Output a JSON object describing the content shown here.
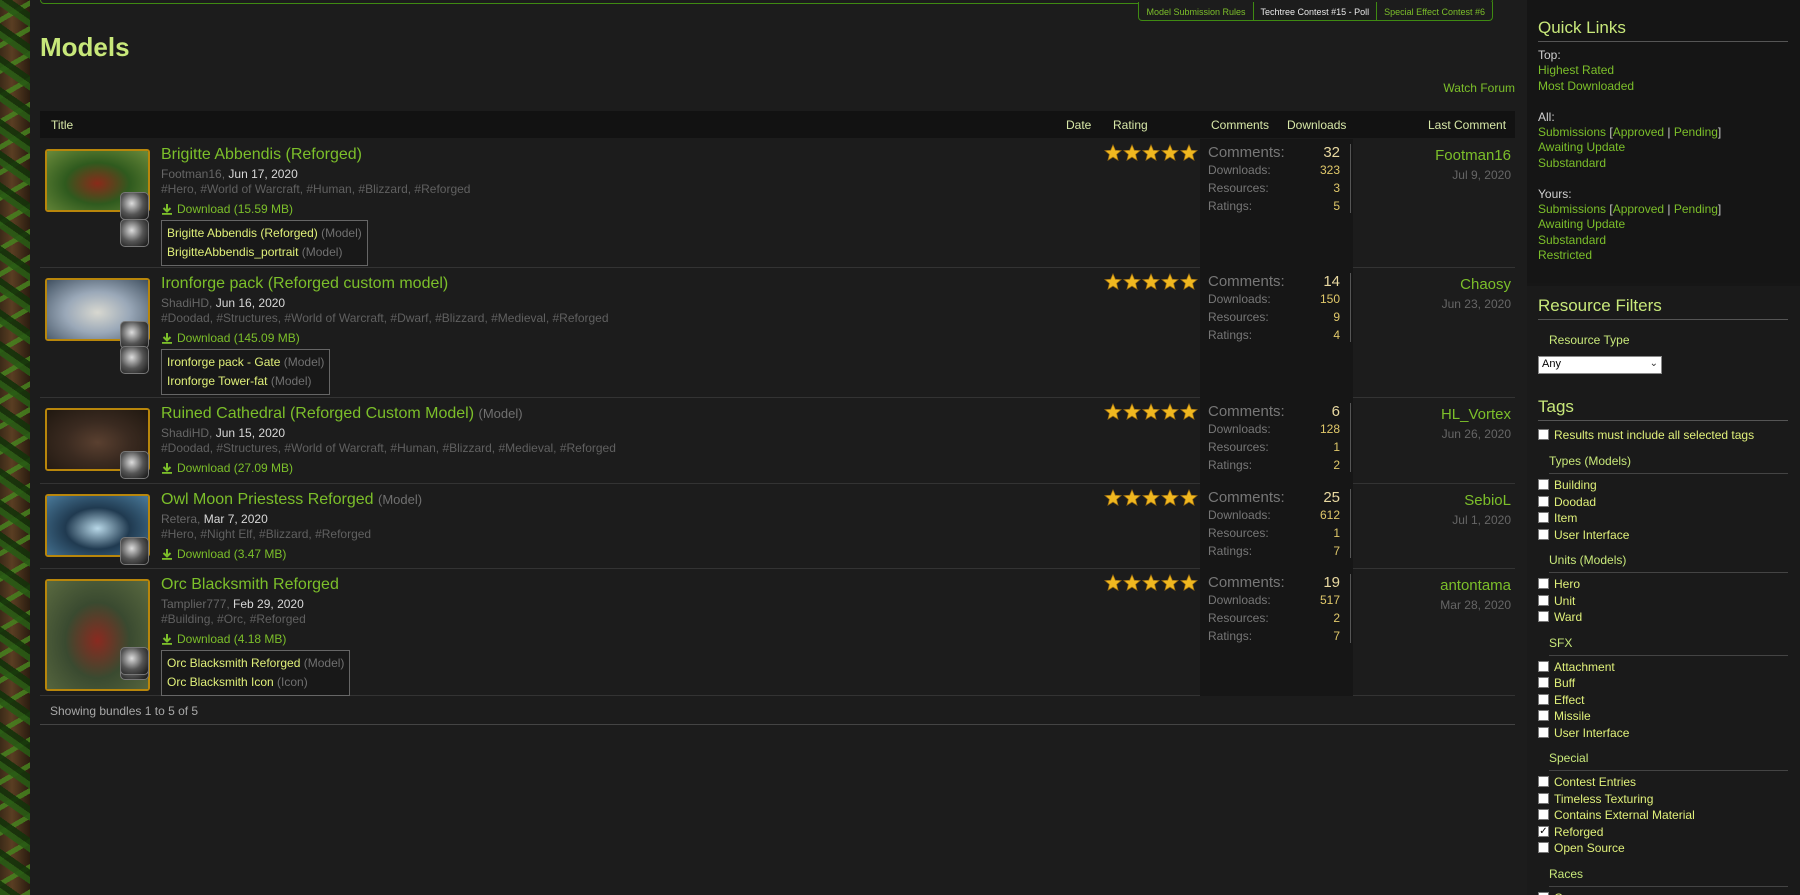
{
  "top_tabs": [
    "Model Submission Rules",
    "Techtree Contest #15 - Poll",
    "Special Effect Contest #6"
  ],
  "page_title": "Models",
  "watch_forum": "Watch Forum",
  "columns": {
    "title": "Title",
    "date": "Date",
    "rating": "Rating",
    "comments": "Comments",
    "downloads": "Downloads",
    "last_comment": "Last Comment"
  },
  "stat_labels": {
    "comments": "Comments:",
    "downloads": "Downloads:",
    "resources": "Resources:",
    "ratings": "Ratings:"
  },
  "rows": [
    {
      "title": "Brigitte Abbendis (Reforged)",
      "type": "",
      "author": "Footman16,",
      "date": "Jun 17, 2020",
      "tags": "#Hero, #World of Warcraft, #Human, #Blizzard, #Reforged",
      "download": "Download (15.59 MB)",
      "files": [
        {
          "name": "Brigitte Abbendis (Reforged)",
          "type": "(Model)"
        },
        {
          "name": "BrigitteAbbendis_portrait",
          "type": "(Model)"
        }
      ],
      "comments": "32",
      "downloads": "323",
      "resources": "3",
      "ratings": "5",
      "rating": 5,
      "last_user": "Footman16",
      "last_date": "Jul 9, 2020"
    },
    {
      "title": "Ironforge pack (Reforged custom model)",
      "type": "",
      "author": "ShadiHD,",
      "date": "Jun 16, 2020",
      "tags": "#Doodad, #Structures, #World of Warcraft, #Dwarf, #Blizzard, #Medieval, #Reforged",
      "download": "Download (145.09 MB)",
      "files": [
        {
          "name": "Ironforge pack - Gate",
          "type": "(Model)"
        },
        {
          "name": "Ironforge Tower-fat",
          "type": "(Model)"
        }
      ],
      "comments": "14",
      "downloads": "150",
      "resources": "9",
      "ratings": "4",
      "rating": 5,
      "last_user": "Chaosy",
      "last_date": "Jun 23, 2020"
    },
    {
      "title": "Ruined Cathedral (Reforged Custom Model)",
      "type": "(Model)",
      "author": "ShadiHD,",
      "date": "Jun 15, 2020",
      "tags": "#Doodad, #Structures, #World of Warcraft, #Human, #Blizzard, #Medieval, #Reforged",
      "download": "Download (27.09 MB)",
      "files": [],
      "comments": "6",
      "downloads": "128",
      "resources": "1",
      "ratings": "2",
      "rating": 5,
      "last_user": "HL_Vortex",
      "last_date": "Jun 26, 2020"
    },
    {
      "title": "Owl Moon Priestess Reforged",
      "type": "(Model)",
      "author": "Retera,",
      "date": "Mar 7, 2020",
      "tags": "#Hero, #Night Elf, #Blizzard, #Reforged",
      "download": "Download (3.47 MB)",
      "files": [],
      "comments": "25",
      "downloads": "612",
      "resources": "1",
      "ratings": "7",
      "rating": 5,
      "last_user": "SebioL",
      "last_date": "Jul 1, 2020"
    },
    {
      "title": "Orc Blacksmith Reforged",
      "type": "",
      "author": "Tamplier777,",
      "date": "Feb 29, 2020",
      "tags": "#Building, #Orc, #Reforged",
      "download": "Download (4.18 MB)",
      "files": [
        {
          "name": "Orc Blacksmith Reforged",
          "type": "(Model)"
        },
        {
          "name": "Orc Blacksmith Icon",
          "type": "(Icon)"
        }
      ],
      "comments": "19",
      "downloads": "517",
      "resources": "2",
      "ratings": "7",
      "rating": 5,
      "last_user": "antontama",
      "last_date": "Mar 28, 2020"
    }
  ],
  "footer": "Showing bundles 1 to 5 of 5",
  "sidebar": {
    "quick_links_title": "Quick Links",
    "top_label": "Top:",
    "highest_rated": "Highest Rated",
    "most_downloaded": "Most Downloaded",
    "all_label": "All:",
    "yours_label": "Yours:",
    "submissions": "Submissions",
    "approved": "Approved",
    "pending": "Pending",
    "awaiting_update": "Awaiting Update",
    "substandard": "Substandard",
    "restricted": "Restricted",
    "filters_title": "Resource Filters",
    "resource_type_label": "Resource Type",
    "resource_type_value": "Any",
    "tags_title": "Tags",
    "must_include": "Results must include all selected tags",
    "groups": [
      {
        "title": "Types (Models)",
        "items": [
          {
            "label": "Building",
            "checked": false
          },
          {
            "label": "Doodad",
            "checked": false
          },
          {
            "label": "Item",
            "checked": false
          },
          {
            "label": "User Interface",
            "checked": false
          }
        ]
      },
      {
        "title": "Units (Models)",
        "items": [
          {
            "label": "Hero",
            "checked": false
          },
          {
            "label": "Unit",
            "checked": false
          },
          {
            "label": "Ward",
            "checked": false
          }
        ]
      },
      {
        "title": "SFX",
        "items": [
          {
            "label": "Attachment",
            "checked": false
          },
          {
            "label": "Buff",
            "checked": false
          },
          {
            "label": "Effect",
            "checked": false
          },
          {
            "label": "Missile",
            "checked": false
          },
          {
            "label": "User Interface",
            "checked": false
          }
        ]
      },
      {
        "title": "Special",
        "items": [
          {
            "label": "Contest Entries",
            "checked": false
          },
          {
            "label": "Timeless Texturing",
            "checked": false
          },
          {
            "label": "Contains External Material",
            "checked": false
          },
          {
            "label": "Reforged",
            "checked": true
          },
          {
            "label": "Open Source",
            "checked": false
          }
        ]
      },
      {
        "title": "Races",
        "items": [
          {
            "label": "Creep",
            "checked": false
          }
        ]
      }
    ]
  }
}
